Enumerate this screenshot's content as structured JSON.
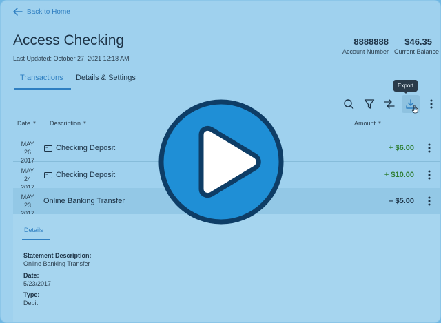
{
  "header": {
    "back_label": "Back to Home",
    "title": "Access Checking",
    "last_updated": "Last Updated: October 27, 2021 12:18 AM",
    "account_number_value": "8888888",
    "account_number_label": "Account Number",
    "balance_value": "$46.35",
    "balance_label": "Current Balance"
  },
  "tabs": [
    {
      "label": "Transactions",
      "active": true
    },
    {
      "label": "Details & Settings",
      "active": false
    }
  ],
  "toolbar": {
    "icons": [
      "search-icon",
      "filter-icon",
      "sort-icon",
      "download-icon",
      "more-vertical-icon"
    ],
    "export_tooltip": "Export"
  },
  "columns": {
    "date": "Date",
    "description": "Description",
    "amount": "Amount"
  },
  "transactions": [
    {
      "month_day": "MAY 26",
      "year": "2017",
      "description": "Checking Deposit",
      "amount": "+ $6.00",
      "has_icon": true
    },
    {
      "month_day": "MAY 24",
      "year": "2017",
      "description": "Checking Deposit",
      "amount": "+ $10.00",
      "has_icon": true
    },
    {
      "month_day": "MAY 23",
      "year": "2017",
      "description": "Online Banking Transfer",
      "amount": "– $5.00",
      "has_icon": false
    }
  ],
  "details": {
    "tab_label": "Details",
    "statement_description_label": "Statement Description:",
    "statement_description_value": "Online Banking Transfer",
    "date_label": "Date:",
    "date_value": "5/23/2017",
    "type_label": "Type:",
    "type_value": "Debit"
  },
  "colors": {
    "accent": "#2f7fc1",
    "positive": "#2e7d32",
    "overlay_play": "#1f8fd6",
    "overlay_play_border": "#0e3d66"
  }
}
